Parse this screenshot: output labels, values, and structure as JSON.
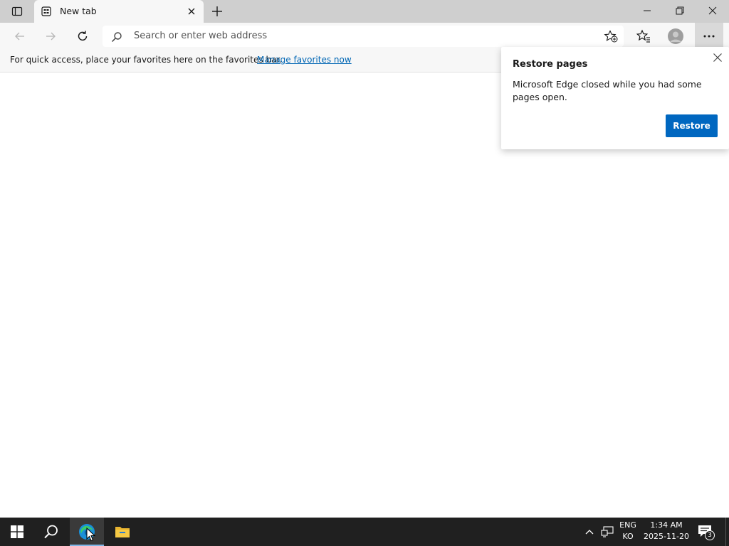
{
  "browser": {
    "tab": {
      "title": "New tab",
      "favicon": "newtab-page-icon"
    },
    "window_controls": [
      "minimize-icon",
      "restore-icon",
      "close-icon"
    ]
  },
  "toolbar": {
    "address_placeholder": "Search or enter web address"
  },
  "favorites_bar": {
    "message": "For quick access, place your favorites here on the favorites bar.",
    "link": "Manage favorites now"
  },
  "popup": {
    "title": "Restore pages",
    "body": "Microsoft Edge closed while you had some pages open.",
    "button": "Restore"
  },
  "taskbar": {
    "apps": [
      "windows-start-icon",
      "search-icon",
      "edge-icon",
      "file-explorer-icon"
    ],
    "language": {
      "line1": "ENG",
      "line2": "KO"
    },
    "clock": {
      "time": "1:34 AM",
      "date": "2025-11-20"
    },
    "notifications_count": "3"
  },
  "colors": {
    "accent": "#0067c0",
    "link": "#0066b4",
    "taskbar": "#202020"
  }
}
